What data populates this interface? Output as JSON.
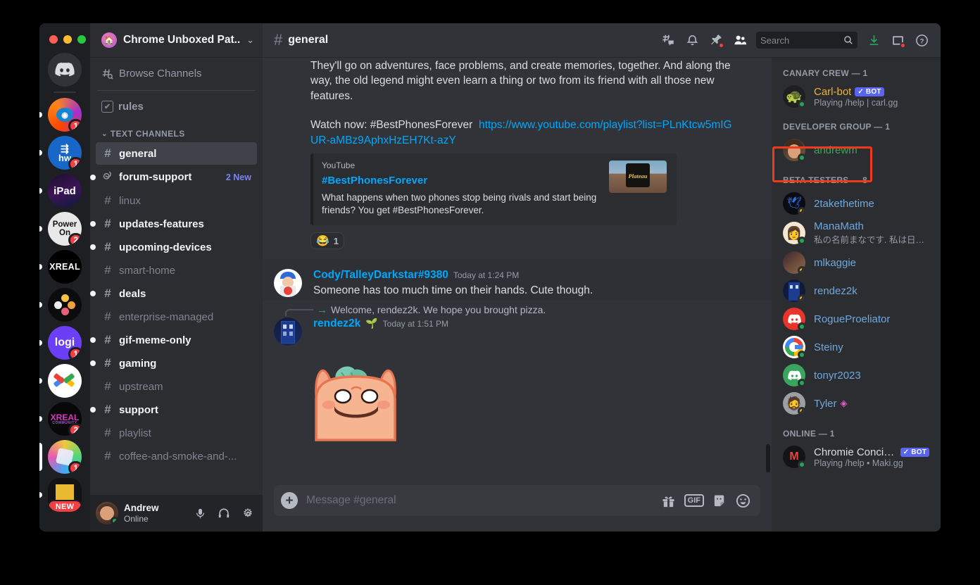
{
  "window": {
    "traffic_lights": [
      "close",
      "minimize",
      "maximize"
    ]
  },
  "server_rail": {
    "home_label": "Discord",
    "servers": [
      {
        "name": "reddit",
        "label": "",
        "badge": "1",
        "pill": "sm"
      },
      {
        "name": "hw",
        "label": "hw",
        "badge": "1",
        "pill": "sm"
      },
      {
        "name": "ipad",
        "label": "iPad",
        "badge": "",
        "pill": "sm"
      },
      {
        "name": "power-on",
        "label": "Power On",
        "badge": "2",
        "pill": "sm"
      },
      {
        "name": "xreal",
        "label": "XREAL",
        "badge": "",
        "pill": "sm"
      },
      {
        "name": "dots",
        "label": "",
        "badge": "",
        "pill": "sm"
      },
      {
        "name": "logi",
        "label": "logi",
        "badge": "1",
        "pill": "sm"
      },
      {
        "name": "google-dev",
        "label": "",
        "badge": "",
        "pill": "sm"
      },
      {
        "name": "xreal-community",
        "label": "XREAL",
        "sublabel": "COMMUNITY",
        "badge": "2",
        "pill": "sm"
      },
      {
        "name": "chrome-unboxed",
        "label": "",
        "badge": "1",
        "pill": "lg"
      },
      {
        "name": "new-server",
        "label": "",
        "badge": "",
        "new_label": "NEW",
        "pill": "sm"
      }
    ]
  },
  "sidebar": {
    "server_name": "Chrome Unboxed Pat...",
    "browse_channels": "Browse Channels",
    "rules_label": "rules",
    "category_label": "TEXT CHANNELS",
    "channels": [
      {
        "name": "general",
        "state": "active",
        "badge": ""
      },
      {
        "name": "forum-support",
        "state": "unread",
        "badge": "2 New",
        "icon": "forum"
      },
      {
        "name": "linux",
        "state": "muted",
        "badge": ""
      },
      {
        "name": "updates-features",
        "state": "unread",
        "badge": ""
      },
      {
        "name": "upcoming-devices",
        "state": "unread",
        "badge": ""
      },
      {
        "name": "smart-home",
        "state": "muted",
        "badge": ""
      },
      {
        "name": "deals",
        "state": "unread",
        "badge": ""
      },
      {
        "name": "enterprise-managed",
        "state": "muted",
        "badge": ""
      },
      {
        "name": "gif-meme-only",
        "state": "unread",
        "badge": ""
      },
      {
        "name": "gaming",
        "state": "unread",
        "badge": ""
      },
      {
        "name": "upstream",
        "state": "muted",
        "badge": ""
      },
      {
        "name": "support",
        "state": "unread",
        "badge": ""
      },
      {
        "name": "playlist",
        "state": "muted",
        "badge": ""
      },
      {
        "name": "coffee-and-smoke-and-...",
        "state": "muted",
        "badge": ""
      }
    ],
    "user_panel": {
      "name": "Andrew",
      "status": "Online"
    }
  },
  "topbar": {
    "channel": "general",
    "search_placeholder": "Search",
    "search_value": "",
    "icons": [
      "threads-icon",
      "bell-icon",
      "pin-icon",
      "members-icon",
      "download-icon",
      "inbox-icon",
      "help-icon"
    ]
  },
  "messages": {
    "continued_text_1": "They'll go on adventures, face problems, and create memories, together. And along the way, the old legend might even learn a thing or two from its friend with all those new features.",
    "watch_prefix": "Watch now: #BestPhonesForever",
    "watch_url": "https://www.youtube.com/playlist?list=PLnKtcw5mIGUR-aMBz9AphxHzEH7Kt-azY",
    "embed": {
      "provider": "YouTube",
      "title": "#BestPhonesForever",
      "description": "What happens when two phones stop being rivals and start being friends? You get #BestPhonesForever.",
      "thumb_caption": "Plateau"
    },
    "reaction": {
      "emoji": "😂",
      "count": "1"
    },
    "msg_cody": {
      "author": "Cody/TalleyDarkstar#9380",
      "timestamp": "Today at 1:24 PM",
      "text": "Someone has too much time on their hands.  Cute though."
    },
    "reply_system": "Welcome, rendez2k. We hope you brought pizza.",
    "msg_rendez": {
      "author": "rendez2k",
      "timestamp": "Today at 1:51 PM",
      "badge_icon": "sprout-emoji"
    }
  },
  "composer": {
    "placeholder": "Message #general",
    "value": "",
    "icons": [
      "gift-icon",
      "gif-icon",
      "sticker-icon",
      "emoji-icon"
    ],
    "gif_label": "GIF"
  },
  "members": {
    "groups": [
      {
        "title": "CANARY CREW — 1",
        "people": [
          {
            "name": "Carl-bot",
            "bot": "BOT",
            "status": "online",
            "activity": "Playing /help | carl.gg",
            "color": "#f0b232",
            "avatar": "turtle"
          }
        ]
      },
      {
        "title": "DEVELOPER GROUP — 1",
        "people": [
          {
            "name": "andrewm",
            "bot": "",
            "status": "online",
            "activity": "",
            "color": "#3ba55d",
            "avatar": "andrew",
            "highlighted": true
          }
        ]
      },
      {
        "title": "BETA TESTERS — 8",
        "people": [
          {
            "name": "2takethetime",
            "bot": "",
            "status": "idle",
            "activity": "",
            "color": "#6fa8dc",
            "avatar": "bird"
          },
          {
            "name": "ManaMath",
            "bot": "",
            "status": "online",
            "activity": "私の名前まなです. 私は日本...",
            "color": "#6fa8dc",
            "avatar": "woman"
          },
          {
            "name": "mlkaggie",
            "bot": "",
            "status": "idle",
            "activity": "",
            "color": "#6fa8dc",
            "avatar": "scene"
          },
          {
            "name": "rendez2k",
            "bot": "",
            "status": "idle",
            "activity": "",
            "color": "#6fa8dc",
            "avatar": "tardis"
          },
          {
            "name": "RogueProeliator",
            "bot": "",
            "status": "online",
            "activity": "",
            "color": "#6fa8dc",
            "avatar": "discord-red"
          },
          {
            "name": "Steiny",
            "bot": "",
            "status": "online",
            "activity": "",
            "color": "#6fa8dc",
            "avatar": "google"
          },
          {
            "name": "tonyr2023",
            "bot": "",
            "status": "online",
            "activity": "",
            "color": "#6fa8dc",
            "avatar": "discord-green"
          },
          {
            "name": "Tyler",
            "bot": "",
            "status": "idle",
            "activity": "",
            "color": "#6fa8dc",
            "avatar": "man",
            "suffix_icon": "nitro-badge"
          }
        ]
      },
      {
        "title": "ONLINE — 1",
        "people": [
          {
            "name": "Chromie Concie...",
            "bot": "BOT",
            "status": "online",
            "activity": "Playing /help • Maki.gg",
            "color": "#dbdee1",
            "avatar": "maki"
          }
        ]
      }
    ]
  }
}
